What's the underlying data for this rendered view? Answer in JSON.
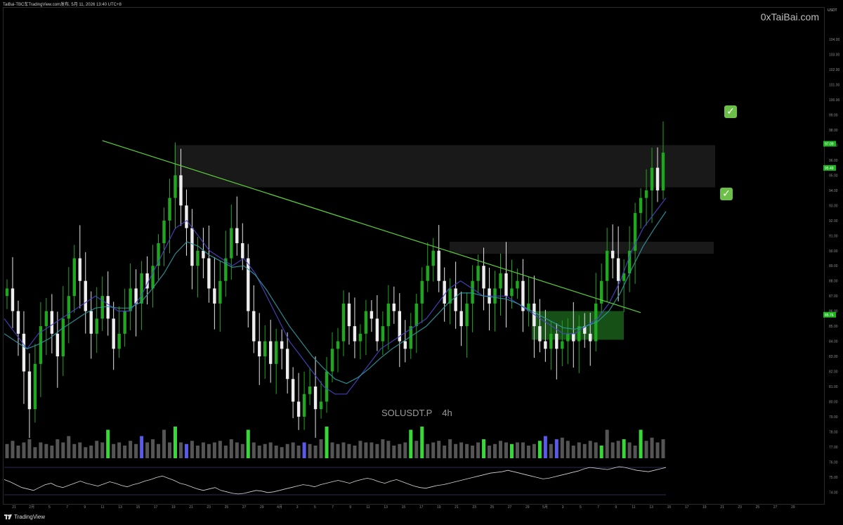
{
  "header": {
    "title": "TaiBai-TBC车TradingView.com发布,  5月 11, 2026 13:40 UTC+8"
  },
  "watermark": "0xTaiBai.com",
  "symbol": {
    "name": "SOLUSDT.P",
    "timeframe": "4h"
  },
  "branding": {
    "logo_text": "TradingView"
  },
  "annotations": {
    "check_icon": "white-check-mark-icon",
    "check_color": "#6cc04a"
  },
  "chart_data": {
    "type": "line",
    "title": "SOLUSDT.P 4h",
    "ylabel": "USDT",
    "ylim": [
      73.5,
      105.5
    ],
    "y_ticks": [
      "104.00",
      "103.00",
      "102.00",
      "101.00",
      "100.00",
      "99.00",
      "98.00",
      "97.00",
      "96.00",
      "95.00",
      "94.00",
      "93.00",
      "92.00",
      "91.00",
      "90.00",
      "89.00",
      "88.00",
      "87.00",
      "86.00",
      "85.00",
      "84.00",
      "83.00",
      "82.00",
      "81.00",
      "80.00",
      "79.00",
      "78.00",
      "77.00",
      "76.00",
      "75.00",
      "74.00"
    ],
    "price_labels": [
      {
        "value": "97.09",
        "color": "#1fb31f"
      },
      {
        "value": "95.49",
        "color": "#1fb31f"
      },
      {
        "value": "85.76",
        "color": "#1fb31f"
      }
    ],
    "x_ticks": [
      "21",
      "2月",
      "5",
      "7",
      "9",
      "11",
      "13",
      "15",
      "17",
      "19",
      "21",
      "23",
      "25",
      "27",
      "29",
      "4月",
      "3",
      "5",
      "7",
      "9",
      "11",
      "13",
      "15",
      "17",
      "19",
      "21",
      "23",
      "25",
      "27",
      "29",
      "5月",
      "3",
      "5",
      "7",
      "9",
      "11",
      "13",
      "15",
      "17",
      "19",
      "21",
      "23",
      "25",
      "27",
      "29"
    ],
    "series": [
      {
        "name": "price",
        "values": [
          87.5,
          86.0,
          84.5,
          82.0,
          79.5,
          82.5,
          85.0,
          86.0,
          84.5,
          83.0,
          85.5,
          87.0,
          89.5,
          88.0,
          86.0,
          84.5,
          85.5,
          87.0,
          85.5,
          83.5,
          84.5,
          86.0,
          87.5,
          86.5,
          88.5,
          87.5,
          89.0,
          90.5,
          92.0,
          93.5,
          95.0,
          93.0,
          91.5,
          89.0,
          90.0,
          89.5,
          87.5,
          86.5,
          88.0,
          89.5,
          91.5,
          90.5,
          89.5,
          86.0,
          84.0,
          83.0,
          84.0,
          82.5,
          84.0,
          83.5,
          81.5,
          80.0,
          79.0,
          80.5,
          81.0,
          79.5,
          80.0,
          82.0,
          83.5,
          84.0,
          86.5,
          85.0,
          84.0,
          84.5,
          86.0,
          85.5,
          84.0,
          85.0,
          86.5,
          86.0,
          84.0,
          83.5,
          85.0,
          86.5,
          88.0,
          89.0,
          90.0,
          88.0,
          86.5,
          87.5,
          86.0,
          85.0,
          86.5,
          88.0,
          89.0,
          87.5,
          86.5,
          87.5,
          88.5,
          87.0,
          87.5,
          88.0,
          86.0,
          86.5,
          85.0,
          84.0,
          83.5,
          84.5,
          83.5,
          84.0,
          84.5,
          84.0,
          85.0,
          84.5,
          84.0,
          86.5,
          88.0,
          90.0,
          89.5,
          88.0,
          88.5,
          90.0,
          92.5,
          93.5,
          94.0,
          95.5,
          94.0,
          96.5
        ],
        "low": 75.0,
        "high": 97.2
      },
      {
        "name": "ema_fast",
        "values": [
          85.5,
          84.5,
          83.5,
          84.5,
          85.0,
          85.5,
          86.0,
          86.5,
          87.0,
          86.5,
          86.0,
          86.0,
          87.0,
          88.5,
          90.0,
          91.5,
          92.0,
          91.0,
          90.0,
          89.5,
          89.0,
          89.5,
          88.5,
          87.0,
          85.5,
          84.0,
          83.0,
          82.0,
          81.0,
          80.5,
          80.5,
          81.5,
          82.5,
          83.5,
          84.0,
          84.5,
          85.0,
          85.5,
          86.5,
          87.5,
          88.0,
          87.5,
          87.0,
          87.0,
          87.0,
          86.5,
          86.0,
          85.5,
          85.0,
          84.5,
          84.5,
          85.0,
          85.5,
          86.5,
          88.0,
          90.0,
          91.5,
          92.5,
          93.5
        ]
      },
      {
        "name": "ema_slow",
        "values": [
          84.5,
          84.0,
          83.5,
          83.8,
          84.2,
          84.8,
          85.3,
          85.8,
          86.2,
          86.3,
          86.2,
          86.2,
          86.6,
          87.5,
          88.5,
          89.8,
          90.6,
          90.3,
          89.7,
          89.3,
          88.9,
          89.0,
          88.4,
          87.4,
          86.2,
          85.0,
          84.0,
          83.0,
          82.2,
          81.5,
          81.2,
          81.6,
          82.2,
          82.9,
          83.5,
          84.0,
          84.5,
          85.0,
          85.8,
          86.6,
          87.2,
          87.2,
          87.0,
          86.9,
          86.8,
          86.5,
          86.1,
          85.7,
          85.3,
          84.9,
          84.8,
          85.0,
          85.3,
          86.0,
          87.2,
          88.8,
          90.3,
          91.5,
          92.6
        ]
      }
    ],
    "trendline": {
      "from": {
        "x_index": 17,
        "y": 97.3
      },
      "to": {
        "x_index": 113,
        "y": 85.9
      },
      "color": "#5ccf3a"
    },
    "zones": [
      {
        "name": "upper-resistance-zone",
        "y_low": 94.2,
        "y_high": 97.0
      },
      {
        "name": "mid-resistance-zone",
        "y_low": 89.8,
        "y_high": 90.6
      },
      {
        "name": "consolidation-box",
        "y_low": 84.1,
        "y_high": 86.0,
        "color": "#1e6b1e"
      }
    ],
    "volume": {
      "values": [
        0.45,
        0.55,
        0.4,
        0.5,
        0.6,
        0.35,
        0.5,
        0.45,
        0.4,
        0.6,
        0.5,
        0.7,
        0.45,
        0.5,
        0.35,
        0.4,
        0.55,
        0.5,
        0.9,
        0.45,
        0.5,
        0.4,
        0.55,
        0.45,
        0.7,
        0.5,
        0.6,
        0.45,
        0.9,
        0.5,
        1.0,
        0.5,
        0.45,
        0.55,
        0.4,
        0.5,
        0.45,
        0.5,
        0.55,
        0.4,
        0.6,
        0.5,
        0.45,
        0.9,
        0.5,
        0.4,
        0.45,
        0.5,
        0.4,
        0.35,
        0.45,
        0.5,
        0.4,
        0.5,
        0.45,
        0.4,
        0.6,
        1.0,
        0.5,
        0.45,
        0.5,
        0.45,
        0.4,
        0.55,
        0.5,
        0.5,
        0.45,
        0.6,
        0.55,
        0.4,
        0.45,
        0.5,
        0.9,
        0.55,
        1.0,
        0.45,
        0.5,
        0.55,
        0.4,
        0.6,
        0.45,
        0.5,
        0.45,
        0.4,
        0.5,
        0.6,
        0.4,
        0.45,
        0.55,
        0.5,
        0.45,
        0.5,
        0.5,
        0.4,
        0.45,
        0.55,
        0.7,
        0.45,
        0.6,
        0.65,
        0.55,
        0.4,
        0.5,
        0.45,
        0.55,
        0.5,
        0.4,
        0.9,
        0.5,
        0.55,
        0.6,
        0.5,
        0.4,
        0.9,
        0.55,
        0.65,
        0.5,
        0.6
      ],
      "highlight_green": [
        18,
        30,
        43,
        57,
        72,
        74,
        85,
        90,
        95,
        106,
        110,
        113
      ],
      "highlight_blue": [
        24,
        32,
        53,
        96,
        98
      ]
    },
    "rsi": {
      "values": [
        55,
        52,
        48,
        44,
        42,
        40,
        44,
        48,
        50,
        46,
        44,
        47,
        50,
        53,
        50,
        48,
        46,
        49,
        52,
        50,
        47,
        45,
        48,
        50,
        53,
        55,
        58,
        60,
        57,
        54,
        50,
        48,
        45,
        42,
        40,
        42,
        44,
        40,
        38,
        36,
        35,
        36,
        38,
        40,
        39,
        37,
        38,
        40,
        42,
        44,
        46,
        48,
        47,
        45,
        48,
        50,
        52,
        54,
        52,
        50,
        53,
        55,
        57,
        55,
        52,
        50,
        53,
        55,
        52,
        49,
        46,
        44,
        43,
        45,
        47,
        48,
        50,
        52,
        54,
        56,
        58,
        60,
        62,
        64,
        65,
        66,
        68,
        66,
        64,
        62,
        60,
        58,
        56,
        57,
        59,
        61,
        63,
        65,
        67,
        70,
        72,
        71,
        70,
        69,
        71,
        73,
        72,
        70,
        68,
        67,
        66,
        68,
        70,
        72
      ]
    }
  }
}
